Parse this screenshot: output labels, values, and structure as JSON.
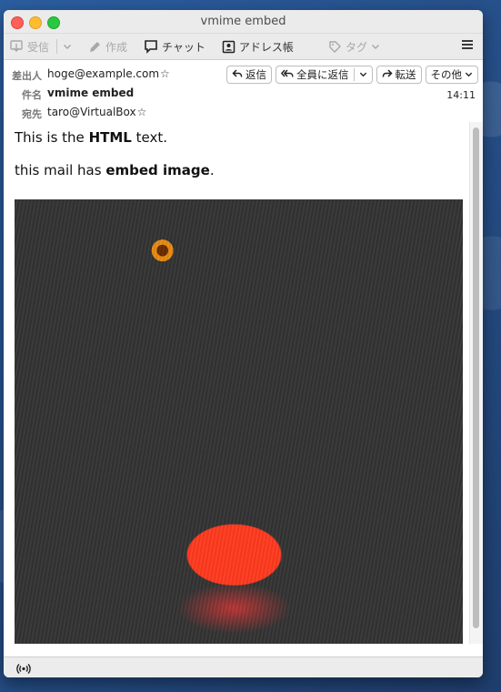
{
  "window": {
    "title": "vmime embed"
  },
  "toolbar": {
    "receive_label": "受信",
    "compose_label": "作成",
    "chat_label": "チャット",
    "addressbook_label": "アドレス帳",
    "tag_label": "タグ"
  },
  "header": {
    "from_label": "差出人",
    "from_value": "hoge@example.com",
    "subject_label": "件名",
    "subject_value": "vmime embed",
    "to_label": "宛先",
    "to_value": "taro@VirtualBox",
    "time": "14:11",
    "reply_label": "返信",
    "reply_all_label": "全員に返信",
    "forward_label": "転送",
    "more_label": "その他"
  },
  "message": {
    "line1_pre": "This is the ",
    "line1_bold": "HTML",
    "line1_post": " text.",
    "line2_pre": "this mail has ",
    "line2_bold": "embed image",
    "line2_post": "."
  },
  "icons": {
    "receive": "download-icon",
    "compose": "pencil-icon",
    "chat": "chat-bubble-icon",
    "addressbook": "contact-card-icon",
    "tag": "tag-icon",
    "menu": "hamburger-icon",
    "status": "wireless-icon"
  }
}
